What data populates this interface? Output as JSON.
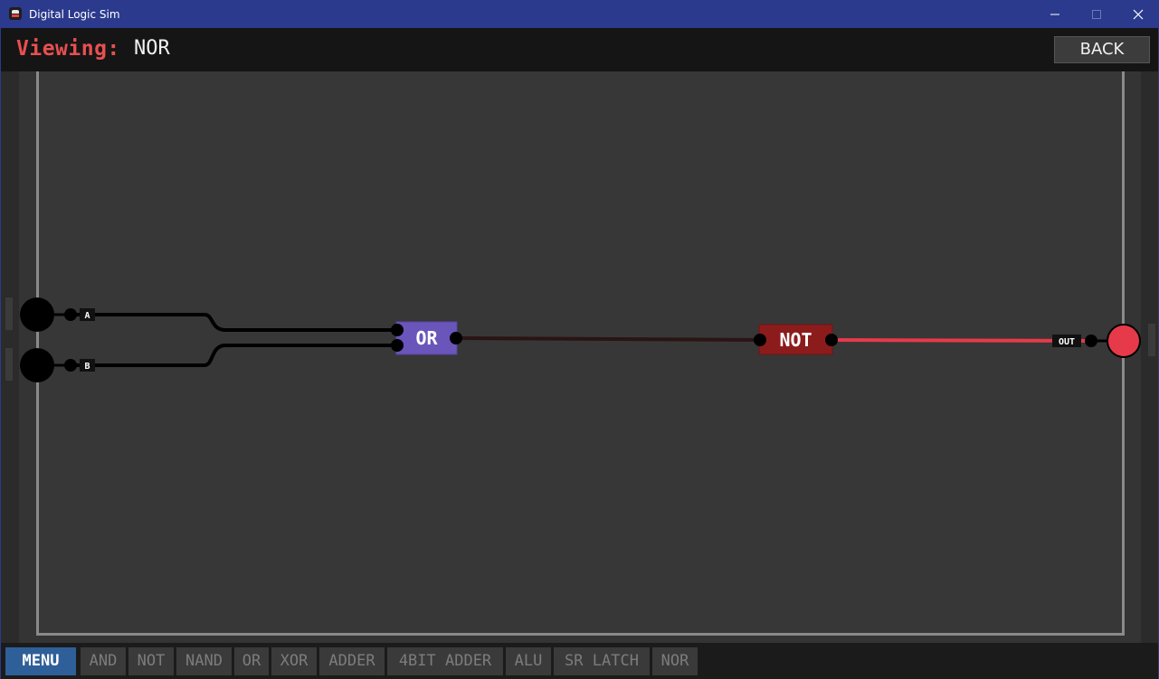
{
  "window": {
    "title": "Digital Logic Sim",
    "minimize_glyph": "—",
    "close_glyph": "✕"
  },
  "header": {
    "viewing_label": "Viewing:",
    "viewing_value": "NOR",
    "back_label": "BACK"
  },
  "circuit": {
    "inputs": [
      {
        "label": "A",
        "state": "off"
      },
      {
        "label": "B",
        "state": "off"
      }
    ],
    "gates": [
      {
        "label": "OR",
        "color": "#6a55bb"
      },
      {
        "label": "NOT",
        "color": "#8c1c1c"
      }
    ],
    "output": {
      "label": "OUT",
      "state": "on",
      "color": "#e63a4a"
    }
  },
  "colors": {
    "accent": "#e85050",
    "menu_button": "#2f5f98",
    "wire_off": "#000000",
    "wire_on": "#e63a4a"
  },
  "bottombar": {
    "menu_label": "MENU",
    "chips": [
      "AND",
      "NOT",
      "NAND",
      "OR",
      "XOR",
      "ADDER",
      "4BIT ADDER",
      "ALU",
      "SR LATCH",
      "NOR"
    ]
  }
}
